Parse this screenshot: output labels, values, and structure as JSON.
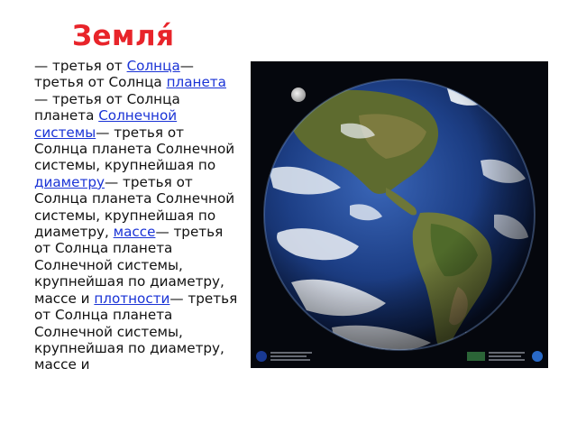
{
  "title": "Земля́",
  "paragraph": [
    {
      "text": "— третья от ",
      "link": false
    },
    {
      "text": "Солнца",
      "link": true
    },
    {
      "text": "— третья от Солнца ",
      "link": false
    },
    {
      "text": "планета",
      "link": true
    },
    {
      "text": "— третья от Солнца планета ",
      "link": false
    },
    {
      "text": "Солнечной системы",
      "link": true
    },
    {
      "text": "— третья от Солнца планета Солнечной системы, крупнейшая по ",
      "link": false
    },
    {
      "text": "диаметру",
      "link": true
    },
    {
      "text": "— третья от Солнца планета Солнечной системы, крупнейшая по диаметру, ",
      "link": false
    },
    {
      "text": "массе",
      "link": true
    },
    {
      "text": "— третья от Солнца планета Солнечной системы, крупнейшая по диаметру, массе и ",
      "link": false
    },
    {
      "text": "плотности",
      "link": true
    },
    {
      "text": "— третья от Солнца планета Солнечной системы, крупнейшая по диаметру, массе и",
      "link": false
    }
  ],
  "image": {
    "subject": "earth-globe-americas",
    "colors": {
      "space": "#05070d",
      "ocean": "#1d3f86",
      "land": "#6f7a3a",
      "title": "#e8242a",
      "link": "#1a33d6"
    }
  }
}
